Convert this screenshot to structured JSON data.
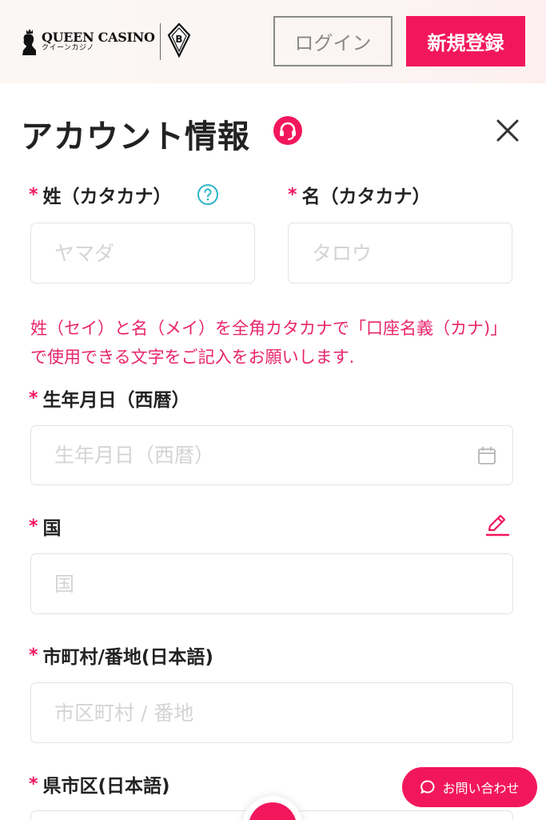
{
  "header": {
    "logo_brand": "QUEEN CASINO",
    "logo_sub": "クイーンカジノ",
    "partner_letter": "B",
    "login_label": "ログイン",
    "register_label": "新規登録"
  },
  "page": {
    "title": "アカウント情報"
  },
  "form": {
    "required_mark": "*",
    "last_name_kana": {
      "label": "姓（カタカナ）",
      "placeholder": "ヤマダ",
      "value": ""
    },
    "first_name_kana": {
      "label": "名（カタカナ）",
      "placeholder": "タロウ",
      "value": ""
    },
    "name_hint": "姓（セイ）と名（メイ）を全角カタカナで「口座名義（カナ)」で使用できる文字をご記入をお願いします.",
    "birthdate": {
      "label": "生年月日（西暦）",
      "placeholder": "生年月日（西暦）",
      "value": ""
    },
    "country": {
      "label": "国",
      "placeholder": "国",
      "value": ""
    },
    "address": {
      "label": "市町村/番地(日本語)",
      "placeholder": "市区町村 / 番地",
      "value": ""
    },
    "prefecture": {
      "label": "県市区(日本語)"
    }
  },
  "chat": {
    "label": "お問い合わせ"
  },
  "icons": {
    "support": "headset-icon",
    "close": "close-icon",
    "help": "question-circle-icon",
    "calendar": "calendar-icon",
    "edit": "pencil-edit-icon",
    "chat": "chat-bubble-icon"
  },
  "colors": {
    "accent": "#f2175d",
    "hint": "#e8256b",
    "help": "#2bb5c8",
    "border": "#e3e3e3",
    "placeholder": "#d4d4d4"
  }
}
